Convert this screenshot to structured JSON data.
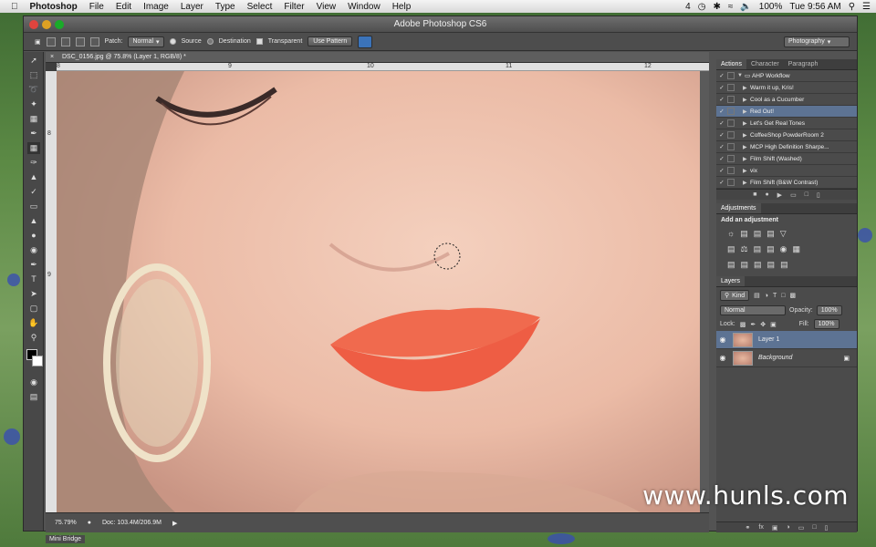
{
  "menubar": {
    "apple": "",
    "items": [
      "Photoshop",
      "File",
      "Edit",
      "Image",
      "Layer",
      "Type",
      "Select",
      "Filter",
      "View",
      "Window",
      "Help"
    ],
    "status": {
      "badge": "4",
      "battery": "100%",
      "clock": "Tue 9:56 AM"
    }
  },
  "window": {
    "title": "Adobe Photoshop CS6"
  },
  "options": {
    "patch_label": "Patch:",
    "patch_mode": "Normal",
    "source": "Source",
    "destination": "Destination",
    "transparent": "Transparent",
    "use_pattern": "Use Pattern",
    "workspace": "Photography"
  },
  "document": {
    "tab": "DSC_0156.jpg @ 75.8% (Layer 1, RGB/8) *",
    "ruler_h": [
      "8",
      "9",
      "10",
      "11",
      "12"
    ],
    "ruler_v": [
      "8",
      "9"
    ],
    "zoom": "75.79%",
    "doc_size": "Doc: 103.4M/206.9M",
    "mini_bridge": "Mini Bridge"
  },
  "actions_panel": {
    "tabs": [
      "Actions",
      "Character",
      "Paragraph"
    ],
    "rows": [
      "AHP Workflow",
      "Warm it up, Kris!",
      "Cool as a Cucumber",
      "Red Out!",
      "Let's Get Real Tones",
      "CoffeeShop PowderRoom 2",
      "MCP High Definition Sharpe...",
      "Film Shift (Washed)",
      "vix",
      "Film Shift (B&W Contrast)"
    ],
    "selected_index": 3
  },
  "adjustments_panel": {
    "title": "Adjustments",
    "subtitle": "Add an adjustment"
  },
  "layers_panel": {
    "title": "Layers",
    "filter": "Kind",
    "blend": "Normal",
    "opacity_label": "Opacity:",
    "opacity": "100%",
    "lock_label": "Lock:",
    "fill_label": "Fill:",
    "fill": "100%",
    "layers": [
      "Layer 1",
      "Background"
    ]
  },
  "watermark": "www.hunls.com"
}
